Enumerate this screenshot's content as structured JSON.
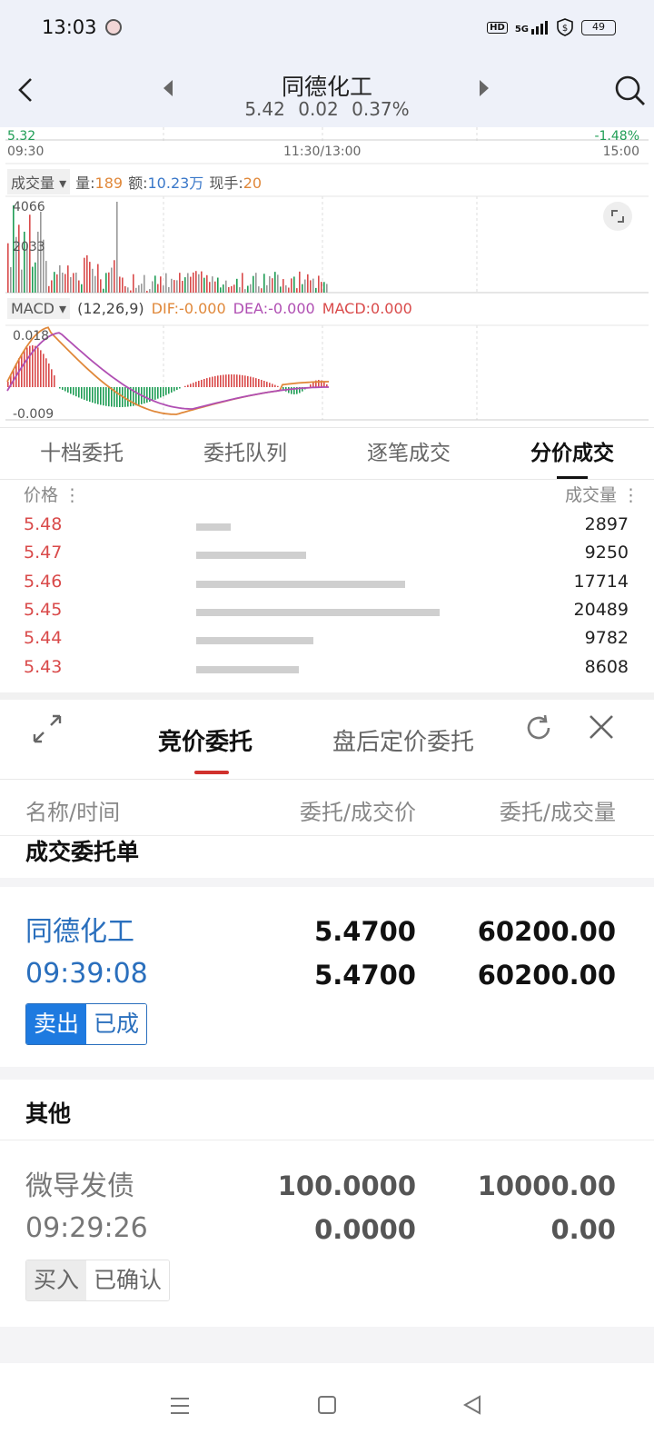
{
  "status_bar": {
    "time": "13:03",
    "network": "5G",
    "hd_label": "HD",
    "battery": "49"
  },
  "header": {
    "title": "同德化工",
    "price": "5.42",
    "change": "0.02",
    "change_pct": "0.37%",
    "icons": [
      "back-arrow-icon",
      "prev-stock-icon",
      "next-stock-icon",
      "search-icon"
    ]
  },
  "chart": {
    "price_high": "5.32",
    "pct_right": "-1.48%",
    "time_start": "09:30",
    "time_mid": "11:30/13:00",
    "time_end": "15:00",
    "volume_selector": "成交量",
    "vol_label": "量:",
    "vol_value": "189",
    "amount_label": "额:",
    "amount_value": "10.23万",
    "hand_label": "现手:",
    "hand_value": "20",
    "vol_axis_top": "4066",
    "vol_axis_mid": "2033",
    "macd_selector": "MACD",
    "macd_params": "(12,26,9)",
    "dif_label": "DIF:-0.000",
    "dea_label": "DEA:-0.000",
    "macd_label": "MACD:0.000",
    "macd_axis_top": "0.018",
    "macd_axis_bottom": "-0.009",
    "colors": {
      "up": "#d94a4a",
      "down": "#1f9d55",
      "dif": "#e0883a",
      "dea": "#b04fb3"
    }
  },
  "tabs": [
    "十档委托",
    "委托队列",
    "逐笔成交",
    "分价成交"
  ],
  "active_tab": 3,
  "price_volume": {
    "price_header": "价格",
    "volume_header": "成交量",
    "rows": [
      {
        "price": "5.48",
        "volume": "2897",
        "ratio": 0.14
      },
      {
        "price": "5.47",
        "volume": "9250",
        "ratio": 0.45
      },
      {
        "price": "5.46",
        "volume": "17714",
        "ratio": 0.86
      },
      {
        "price": "5.45",
        "volume": "20489",
        "ratio": 1.0
      },
      {
        "price": "5.44",
        "volume": "9782",
        "ratio": 0.48
      },
      {
        "price": "5.43",
        "volume": "8608",
        "ratio": 0.42
      }
    ]
  },
  "sheet": {
    "tab_active": "竞价委托",
    "tab_other": "盘后定价委托",
    "col_name": "名称/时间",
    "col_price": "委托/成交价",
    "col_qty": "委托/成交量",
    "section_filled": "成交委托单",
    "section_other": "其他",
    "record1": {
      "name": "同德化工",
      "time": "09:39:08",
      "price1": "5.4700",
      "price2": "5.4700",
      "qty1": "60200.00",
      "qty2": "60200.00",
      "side": "卖出",
      "status": "已成"
    },
    "record2": {
      "name": "微导发债",
      "time": "09:29:26",
      "price1": "100.0000",
      "price2": "0.0000",
      "qty1": "10000.00",
      "qty2": "0.00",
      "side": "买入",
      "status": "已确认"
    }
  }
}
